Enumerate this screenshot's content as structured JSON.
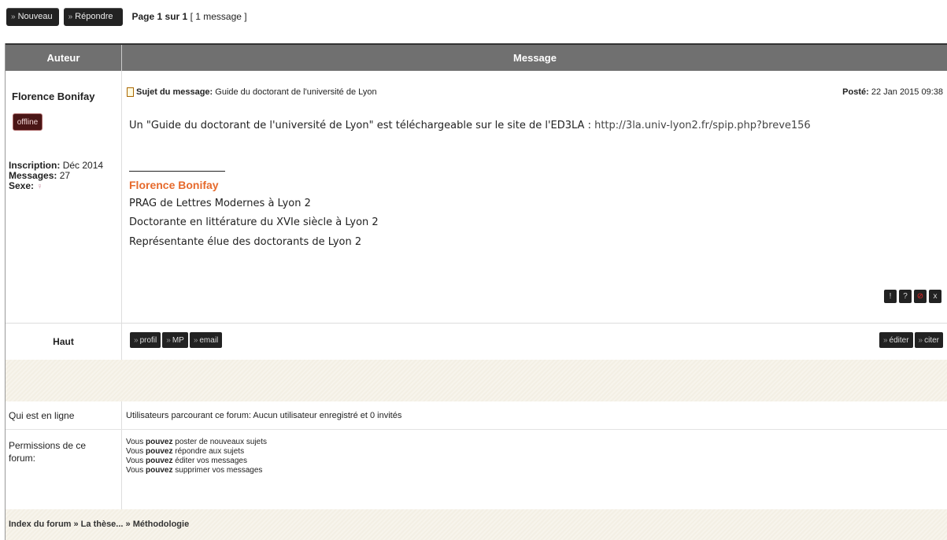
{
  "toolbar": {
    "new_label": "Nouveau",
    "reply_label": "Répondre",
    "page_prefix": "Page 1 sur 1",
    "message_count": "[ 1 message ]"
  },
  "table": {
    "col_author": "Auteur",
    "col_message": "Message"
  },
  "author": {
    "name": "Florence Bonifay",
    "status": "offline",
    "inscription_label": "Inscription:",
    "inscription_value": "Déc 2014",
    "messages_label": "Messages:",
    "messages_value": "27",
    "sex_label": "Sexe:"
  },
  "post": {
    "subject_label": "Sujet du message:",
    "subject_value": "Guide du doctorant de l'université de Lyon",
    "posted_label": "Posté:",
    "posted_value": "22 Jan 2015 09:38",
    "body_text": "Un \"Guide du doctorant de l'université de Lyon\" est téléchargeable sur le site de l'ED3LA : ",
    "body_link": "http://3la.univ-lyon2.fr/spip.php?breve156",
    "signature_name": "Florence Bonifay",
    "signature_lines": [
      "PRAG de Lettres Modernes à Lyon 2",
      "Doctorante en littérature du XVIe siècle à Lyon 2",
      "Représentante élue des doctorants de Lyon 2"
    ],
    "action_icons": [
      "!",
      "?",
      "⊘",
      "x"
    ]
  },
  "footer_row": {
    "top_label": "Haut",
    "profile_btn": "profil",
    "pm_btn": "MP",
    "email_btn": "email",
    "edit_btn": "éditer",
    "quote_btn": "citer"
  },
  "online": {
    "label": "Qui est en ligne",
    "value": "Utilisateurs parcourant ce forum: Aucun utilisateur enregistré et 0 invités"
  },
  "permissions": {
    "label": "Permissions de ce forum:",
    "prefix": "Vous",
    "verb": "pouvez",
    "lines": [
      "poster de nouveaux sujets",
      "répondre aux sujets",
      "éditer vos messages",
      "supprimer vos messages"
    ]
  },
  "breadcrumb": "Index du forum » La thèse... » Méthodologie"
}
